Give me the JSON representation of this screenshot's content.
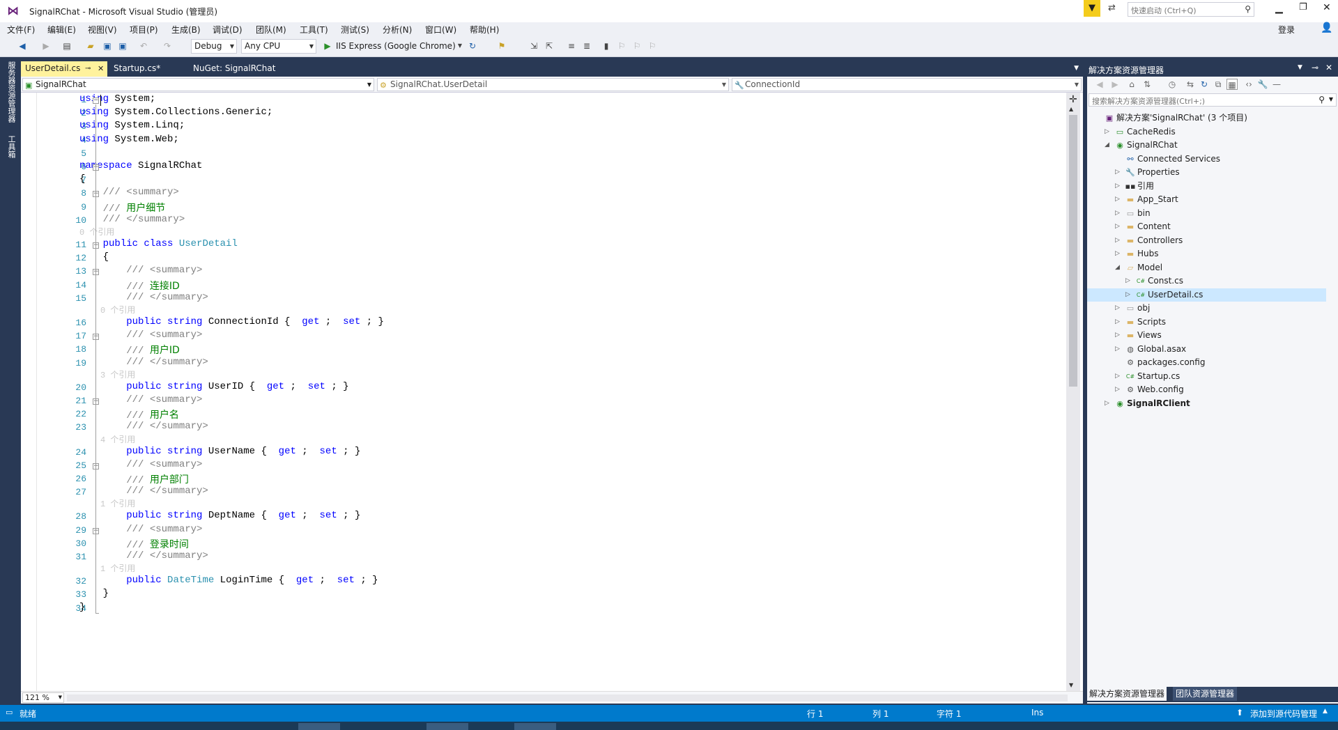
{
  "titlebar": {
    "title": "SignalRChat - Microsoft Visual Studio (管理员)",
    "quick_launch_placeholder": "快速启动 (Ctrl+Q)",
    "login_label": "登录"
  },
  "menu": [
    "文件(F)",
    "编辑(E)",
    "视图(V)",
    "项目(P)",
    "生成(B)",
    "调试(D)",
    "团队(M)",
    "工具(T)",
    "测试(S)",
    "分析(N)",
    "窗口(W)",
    "帮助(H)"
  ],
  "toolbar": {
    "config": "Debug",
    "platform": "Any CPU",
    "run_label": "IIS Express (Google Chrome)"
  },
  "left_strip": {
    "server_explorer": "服务器资源管理器",
    "toolbox": "工具箱"
  },
  "tabs": [
    {
      "label": "UserDetail.cs",
      "active": true
    },
    {
      "label": "Startup.cs*",
      "active": false
    },
    {
      "label": "NuGet: SignalRChat",
      "active": false
    }
  ],
  "navbar": {
    "project": "SignalRChat",
    "class": "SignalRChat.UserDetail",
    "member": "ConnectionId"
  },
  "code": {
    "lines": [
      {
        "n": "1",
        "parts": [
          [
            "kw",
            "using"
          ],
          [
            "",
            "System;"
          ]
        ]
      },
      {
        "n": "2",
        "parts": [
          [
            "kw",
            "using"
          ],
          [
            "",
            "System.Collections.Generic;"
          ]
        ]
      },
      {
        "n": "3",
        "parts": [
          [
            "kw",
            "using"
          ],
          [
            "",
            "System.Linq;"
          ]
        ]
      },
      {
        "n": "4",
        "parts": [
          [
            "kw",
            "using"
          ],
          [
            "",
            "System.Web;"
          ]
        ]
      },
      {
        "n": "5",
        "parts": []
      },
      {
        "n": "6",
        "parts": [
          [
            "kw",
            "namespace"
          ],
          [
            "",
            "SignalRChat"
          ]
        ]
      },
      {
        "n": "7",
        "parts": [
          [
            "",
            "{"
          ]
        ]
      },
      {
        "n": "8",
        "parts": [
          [
            "",
            "    "
          ],
          [
            "cm",
            "/// <summary>"
          ]
        ]
      },
      {
        "n": "9",
        "parts": [
          [
            "",
            "    "
          ],
          [
            "cm",
            "/// "
          ],
          [
            "cmt",
            "用户细节"
          ]
        ]
      },
      {
        "n": "10",
        "parts": [
          [
            "",
            "    "
          ],
          [
            "cm",
            "/// </summary>"
          ]
        ]
      },
      {
        "n": "11",
        "parts": [
          [
            "",
            "    "
          ],
          [
            "kw",
            "public class"
          ],
          [
            "ty",
            "UserDetail"
          ]
        ]
      },
      {
        "n": "12",
        "parts": [
          [
            "",
            "    {"
          ]
        ]
      },
      {
        "n": "13",
        "parts": [
          [
            "",
            "        "
          ],
          [
            "cm",
            "/// <summary>"
          ]
        ]
      },
      {
        "n": "14",
        "parts": [
          [
            "",
            "        "
          ],
          [
            "cm",
            "/// "
          ],
          [
            "cmt",
            "连接ID"
          ]
        ]
      },
      {
        "n": "15",
        "parts": [
          [
            "",
            "        "
          ],
          [
            "cm",
            "/// </summary>"
          ]
        ]
      },
      {
        "n": "16",
        "parts": [
          [
            "",
            "        "
          ],
          [
            "kw",
            "public string"
          ],
          [
            "",
            "ConnectionId { "
          ],
          [
            "kw",
            "get"
          ],
          [
            "",
            "; "
          ],
          [
            "kw",
            "set"
          ],
          [
            "",
            "; }"
          ]
        ]
      },
      {
        "n": "17",
        "parts": [
          [
            "",
            "        "
          ],
          [
            "cm",
            "/// <summary>"
          ]
        ]
      },
      {
        "n": "18",
        "parts": [
          [
            "",
            "        "
          ],
          [
            "cm",
            "/// "
          ],
          [
            "cmt",
            "用户ID"
          ]
        ]
      },
      {
        "n": "19",
        "parts": [
          [
            "",
            "        "
          ],
          [
            "cm",
            "/// </summary>"
          ]
        ]
      },
      {
        "n": "20",
        "parts": [
          [
            "",
            "        "
          ],
          [
            "kw",
            "public string"
          ],
          [
            "",
            "UserID { "
          ],
          [
            "kw",
            "get"
          ],
          [
            "",
            "; "
          ],
          [
            "kw",
            "set"
          ],
          [
            "",
            "; }"
          ]
        ]
      },
      {
        "n": "21",
        "parts": [
          [
            "",
            "        "
          ],
          [
            "cm",
            "/// <summary>"
          ]
        ]
      },
      {
        "n": "22",
        "parts": [
          [
            "",
            "        "
          ],
          [
            "cm",
            "/// "
          ],
          [
            "cmt",
            "用户名"
          ]
        ]
      },
      {
        "n": "23",
        "parts": [
          [
            "",
            "        "
          ],
          [
            "cm",
            "/// </summary>"
          ]
        ]
      },
      {
        "n": "24",
        "parts": [
          [
            "",
            "        "
          ],
          [
            "kw",
            "public string"
          ],
          [
            "",
            "UserName { "
          ],
          [
            "kw",
            "get"
          ],
          [
            "",
            "; "
          ],
          [
            "kw",
            "set"
          ],
          [
            "",
            "; }"
          ]
        ]
      },
      {
        "n": "25",
        "parts": [
          [
            "",
            "        "
          ],
          [
            "cm",
            "/// <summary>"
          ]
        ]
      },
      {
        "n": "26",
        "parts": [
          [
            "",
            "        "
          ],
          [
            "cm",
            "/// "
          ],
          [
            "cmt",
            "用户部门"
          ]
        ]
      },
      {
        "n": "27",
        "parts": [
          [
            "",
            "        "
          ],
          [
            "cm",
            "/// </summary>"
          ]
        ]
      },
      {
        "n": "28",
        "parts": [
          [
            "",
            "        "
          ],
          [
            "kw",
            "public string"
          ],
          [
            "",
            "DeptName { "
          ],
          [
            "kw",
            "get"
          ],
          [
            "",
            "; "
          ],
          [
            "kw",
            "set"
          ],
          [
            "",
            "; }"
          ]
        ]
      },
      {
        "n": "29",
        "parts": [
          [
            "",
            "        "
          ],
          [
            "cm",
            "/// <summary>"
          ]
        ]
      },
      {
        "n": "30",
        "parts": [
          [
            "",
            "        "
          ],
          [
            "cm",
            "/// "
          ],
          [
            "cmt",
            "登录时间"
          ]
        ]
      },
      {
        "n": "31",
        "parts": [
          [
            "",
            "        "
          ],
          [
            "cm",
            "/// </summary>"
          ]
        ]
      },
      {
        "n": "32",
        "parts": [
          [
            "",
            "        "
          ],
          [
            "kw",
            "public"
          ],
          [
            "ty",
            "DateTime"
          ],
          [
            "",
            "LoginTime { "
          ],
          [
            "kw",
            "get"
          ],
          [
            "",
            "; "
          ],
          [
            "kw",
            "set"
          ],
          [
            "",
            "; }"
          ]
        ]
      },
      {
        "n": "33",
        "parts": [
          [
            "",
            "    }"
          ]
        ]
      },
      {
        "n": "34",
        "parts": [
          [
            "",
            "}"
          ]
        ]
      }
    ],
    "lens": [
      "0 个引用",
      "0 个引用",
      "3 个引用",
      "4 个引用",
      "1 个引用",
      "1 个引用"
    ]
  },
  "zoom": "121 %",
  "solution_explorer": {
    "title": "解决方案资源管理器",
    "search_placeholder": "搜索解决方案资源管理器(Ctrl+;)",
    "items": [
      {
        "label": "解决方案'SignalRChat' (3 个项目)",
        "icon": "solution-icon",
        "exp": ""
      },
      {
        "label": "CacheRedis",
        "icon": "project-icon",
        "exp": "▷"
      },
      {
        "label": "SignalRChat",
        "icon": "web-project-icon",
        "exp": "◢"
      },
      {
        "label": "Connected Services",
        "icon": "connected-services-icon",
        "exp": ""
      },
      {
        "label": "Properties",
        "icon": "wrench-icon",
        "exp": "▷"
      },
      {
        "label": "引用",
        "icon": "references-icon",
        "exp": "▷"
      },
      {
        "label": "App_Start",
        "icon": "folder-icon",
        "exp": "▷"
      },
      {
        "label": "bin",
        "icon": "folder-outline-icon",
        "exp": "▷"
      },
      {
        "label": "Content",
        "icon": "folder-icon",
        "exp": "▷"
      },
      {
        "label": "Controllers",
        "icon": "folder-icon",
        "exp": "▷"
      },
      {
        "label": "Hubs",
        "icon": "folder-icon",
        "exp": "▷"
      },
      {
        "label": "Model",
        "icon": "folder-open-icon",
        "exp": "◢"
      },
      {
        "label": "Const.cs",
        "icon": "csharp-file-icon",
        "exp": "▷"
      },
      {
        "label": "UserDetail.cs",
        "icon": "csharp-file-icon",
        "exp": "▷"
      },
      {
        "label": "obj",
        "icon": "folder-outline-icon",
        "exp": "▷"
      },
      {
        "label": "Scripts",
        "icon": "folder-icon",
        "exp": "▷"
      },
      {
        "label": "Views",
        "icon": "folder-icon",
        "exp": "▷"
      },
      {
        "label": "Global.asax",
        "icon": "asax-file-icon",
        "exp": "▷"
      },
      {
        "label": "packages.config",
        "icon": "config-file-icon",
        "exp": ""
      },
      {
        "label": "Startup.cs",
        "icon": "csharp-file-icon",
        "exp": "▷"
      },
      {
        "label": "Web.config",
        "icon": "config-file-icon",
        "exp": "▷"
      },
      {
        "label": "SignalRClient",
        "icon": "web-project-icon",
        "exp": "▷"
      }
    ],
    "bottom_tabs": [
      "解决方案资源管理器",
      "团队资源管理器"
    ]
  },
  "status": {
    "ready": "就绪",
    "row": "行 1",
    "col": "列 1",
    "char": "字符 1",
    "mode": "Ins",
    "source_control": "添加到源代码管理"
  },
  "colors": {
    "accent": "#007acc",
    "chrome": "#293955",
    "active_tab": "#fff29d",
    "keyword": "#0000ff",
    "type": "#2b91af",
    "comment_green": "#008000"
  }
}
